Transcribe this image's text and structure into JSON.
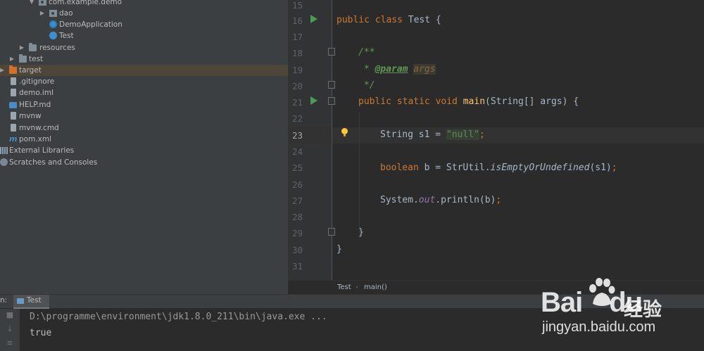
{
  "project_tree": {
    "items": [
      {
        "label": "com.example.demo",
        "icon": "package-icon",
        "expanded": true
      },
      {
        "label": "dao",
        "icon": "package-icon",
        "expanded": false
      },
      {
        "label": "DemoApplication",
        "icon": "spring-class-icon"
      },
      {
        "label": "Test",
        "icon": "class-icon"
      },
      {
        "label": "resources",
        "icon": "folder-icon",
        "expanded": false
      },
      {
        "label": "test",
        "icon": "folder-icon",
        "expanded": false
      },
      {
        "label": "target",
        "icon": "excluded-folder-icon",
        "expanded": false,
        "selected": true
      },
      {
        "label": ".gitignore",
        "icon": "file-icon"
      },
      {
        "label": "demo.iml",
        "icon": "module-file-icon"
      },
      {
        "label": "HELP.md",
        "icon": "markdown-icon"
      },
      {
        "label": "mvnw",
        "icon": "file-icon"
      },
      {
        "label": "mvnw.cmd",
        "icon": "file-icon"
      },
      {
        "label": "pom.xml",
        "icon": "maven-icon"
      },
      {
        "label": "External Libraries",
        "icon": "library-icon",
        "expanded": false
      },
      {
        "label": "Scratches and Consoles",
        "icon": "scratch-icon",
        "expanded": false
      }
    ]
  },
  "editor": {
    "line_numbers": [
      "15",
      "16",
      "17",
      "18",
      "19",
      "20",
      "21",
      "22",
      "23",
      "24",
      "25",
      "26",
      "27",
      "28",
      "29",
      "30",
      "31"
    ],
    "current_line": "23",
    "code": {
      "l16_kw": "public class",
      "l16_rest": " Test {",
      "l18": "/**",
      "l19_star": " * ",
      "l19_tag": "@param",
      "l19_sp": " ",
      "l19_param": "args",
      "l20": " */",
      "l21_kw": "public static void",
      "l21_sp": " ",
      "l21_fn": "main",
      "l21_rest": "(String[] args) {",
      "l23_type": "String s1 = ",
      "l23_str": "\"null\"",
      "l23_end": ";",
      "l25_kw": "boolean",
      "l25_mid": " b = StrUtil.",
      "l25_fn": "isEmptyOrUndefined",
      "l25_arg": "(s1)",
      "l25_end": ";",
      "l27_a": "System.",
      "l27_field": "out",
      "l27_b": ".println(b)",
      "l27_end": ";",
      "l29": "}",
      "l30": "}"
    }
  },
  "breadcrumb": {
    "class_name": "Test",
    "separator": "›",
    "method_name": "main()"
  },
  "run_panel": {
    "prefix": "n:",
    "tab_label": "Test",
    "console_lines": [
      "D:\\programme\\environment\\jdk1.8.0_211\\bin\\java.exe ...",
      "true"
    ],
    "side_icons": [
      "stop-icon",
      "scroll-down-icon",
      "wrap-icon"
    ]
  },
  "watermark": {
    "brand": "Bai",
    "brand_suffix": "du",
    "cn_text": "经验",
    "url": "jingyan.baidu.com"
  },
  "colors": {
    "tree_bg": "#3c3f41",
    "editor_bg": "#2b2b2b",
    "keyword": "#cc7832",
    "string": "#6a8759",
    "method": "#ffc66d",
    "run_green": "#499c54"
  }
}
